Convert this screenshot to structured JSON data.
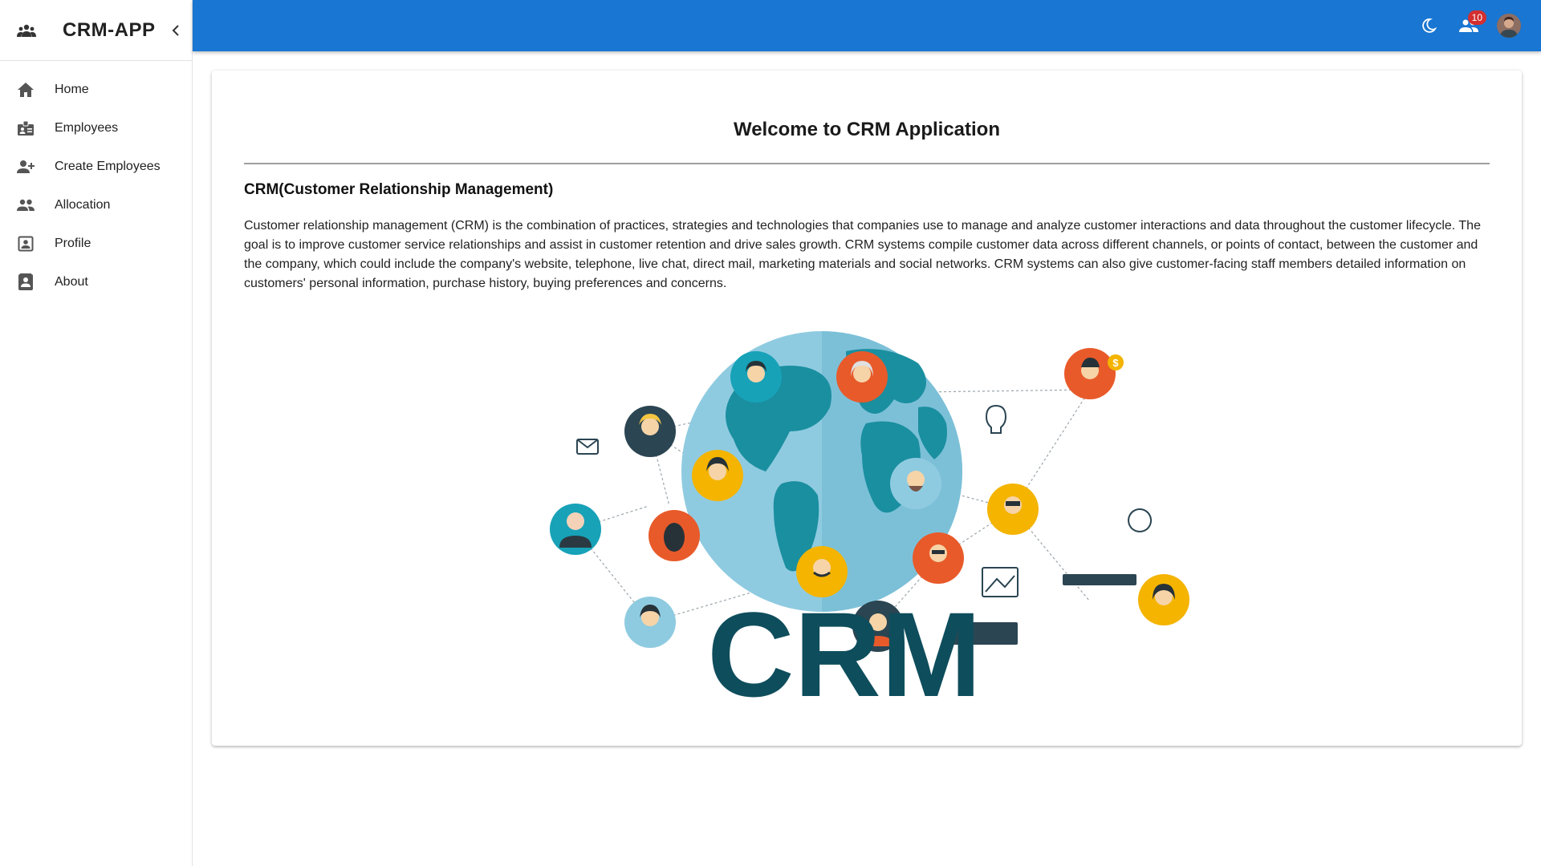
{
  "app": {
    "brand": "CRM-APP"
  },
  "sidebar": {
    "items": [
      {
        "label": "Home",
        "icon": "home-icon"
      },
      {
        "label": "Employees",
        "icon": "badge-icon"
      },
      {
        "label": "Create Employees",
        "icon": "person-add-icon"
      },
      {
        "label": "Allocation",
        "icon": "people-icon"
      },
      {
        "label": "Profile",
        "icon": "account-box-icon"
      },
      {
        "label": "About",
        "icon": "contact-page-icon"
      }
    ]
  },
  "topbar": {
    "notifications_count": "10",
    "icons": [
      "dark-mode-icon",
      "people-notification-icon",
      "user-avatar"
    ]
  },
  "main": {
    "title": "Welcome to CRM Application",
    "section_title": "CRM(Customer Relationship Management)",
    "paragraph": "Customer relationship management (CRM) is the combination of practices, strategies and technologies that companies use to manage and analyze customer interactions and data throughout the customer lifecycle. The goal is to improve customer service relationships and assist in customer retention and drive sales growth. CRM systems compile customer data across different channels, or points of contact, between the customer and the company, which could include the company's website, telephone, live chat, direct mail, marketing materials and social networks. CRM systems can also give customer-facing staff members detailed information on customers' personal information, purchase history, buying preferences and concerns.",
    "illustration_text": "CRM"
  },
  "colors": {
    "appbar": "#1976d2",
    "crm_text": "#0e4d5c",
    "globe_light": "#8fcbe0",
    "globe_land": "#1a8fa0",
    "badge": "#d32f2f"
  }
}
